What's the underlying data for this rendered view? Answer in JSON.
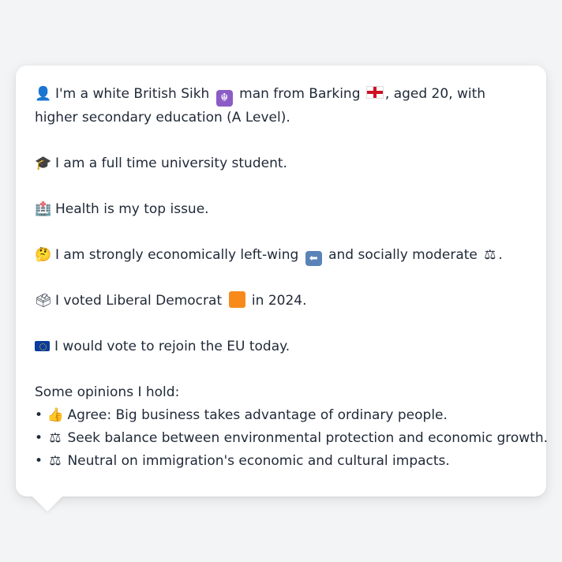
{
  "bio": {
    "identity_icon": "👤",
    "identity_text_1": "I'm a white British Sikh",
    "sikh_icon": "☬",
    "identity_text_2": "man from Barking",
    "identity_text_3": ", aged 20, with higher secondary education (A Level).",
    "student_icon": "🎓",
    "student_text": "I am a full time university student.",
    "health_icon": "🏥",
    "health_text": "Health is my top issue.",
    "thinking_icon": "🤔",
    "politics_text_1": "I am strongly economically left-wing",
    "left_arrow_icon": "⬅",
    "politics_text_2": "and socially moderate",
    "scales_icon": "⚖",
    "politics_text_3": ".",
    "ballot_icon": "🗳",
    "vote_text_1": "I voted Liberal Democrat",
    "vote_text_2": "in 2024.",
    "eu_text": "I would vote to rejoin the EU today."
  },
  "opinions": {
    "heading": "Some opinions I hold:",
    "items": [
      {
        "bullet": "•",
        "icon": "👍",
        "text": "Agree: Big business takes advantage of ordinary people."
      },
      {
        "bullet": "•",
        "icon": "⚖",
        "text": "Seek balance between environmental protection and economic growth."
      },
      {
        "bullet": "•",
        "icon": "⚖",
        "text": "Neutral on immigration's economic and cultural impacts."
      }
    ]
  },
  "colors": {
    "background": "#f3f4f6",
    "card": "#ffffff",
    "text": "#1f2937",
    "lib_dem_orange": "#f88a1c",
    "eu_blue": "#0b3c9e"
  }
}
